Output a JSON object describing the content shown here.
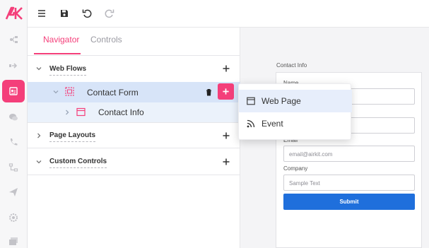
{
  "toolbar": {
    "menu_icon": "hamburger-menu-icon",
    "save_icon": "save-icon",
    "undo_icon": "undo-icon",
    "redo_icon": "redo-icon"
  },
  "rail": {
    "logo": "AK",
    "items": [
      "flow-icon",
      "arrow-right-icon",
      "app-builder-icon",
      "chat-icon",
      "call-icon",
      "data-icon",
      "send-icon",
      "settings-icon",
      "gallery-icon"
    ],
    "active_index": 2
  },
  "panel": {
    "tabs": [
      "Navigator",
      "Controls"
    ],
    "active_tab": 0,
    "sections": {
      "web_flows": "Web Flows",
      "contact_form": "Contact Form",
      "contact_info": "Contact Info",
      "page_layouts": "Page Layouts",
      "custom_controls": "Custom Controls"
    }
  },
  "menu": {
    "items": [
      {
        "label": "Web Page",
        "icon": "web-page-icon"
      },
      {
        "label": "Event",
        "icon": "rss-event-icon"
      }
    ]
  },
  "preview": {
    "title": "Contact Info",
    "fields": [
      {
        "label": "Name",
        "placeholder": ""
      },
      {
        "label": "",
        "placeholder": ""
      },
      {
        "label": "Email",
        "placeholder": "email@airkit.com"
      },
      {
        "label": "Company",
        "placeholder": "Sample Text"
      }
    ],
    "submit": "Submit"
  },
  "colors": {
    "accent": "#f43f7a",
    "selected_row": "#d7e4f8",
    "submit_button": "#1f6fdc"
  }
}
